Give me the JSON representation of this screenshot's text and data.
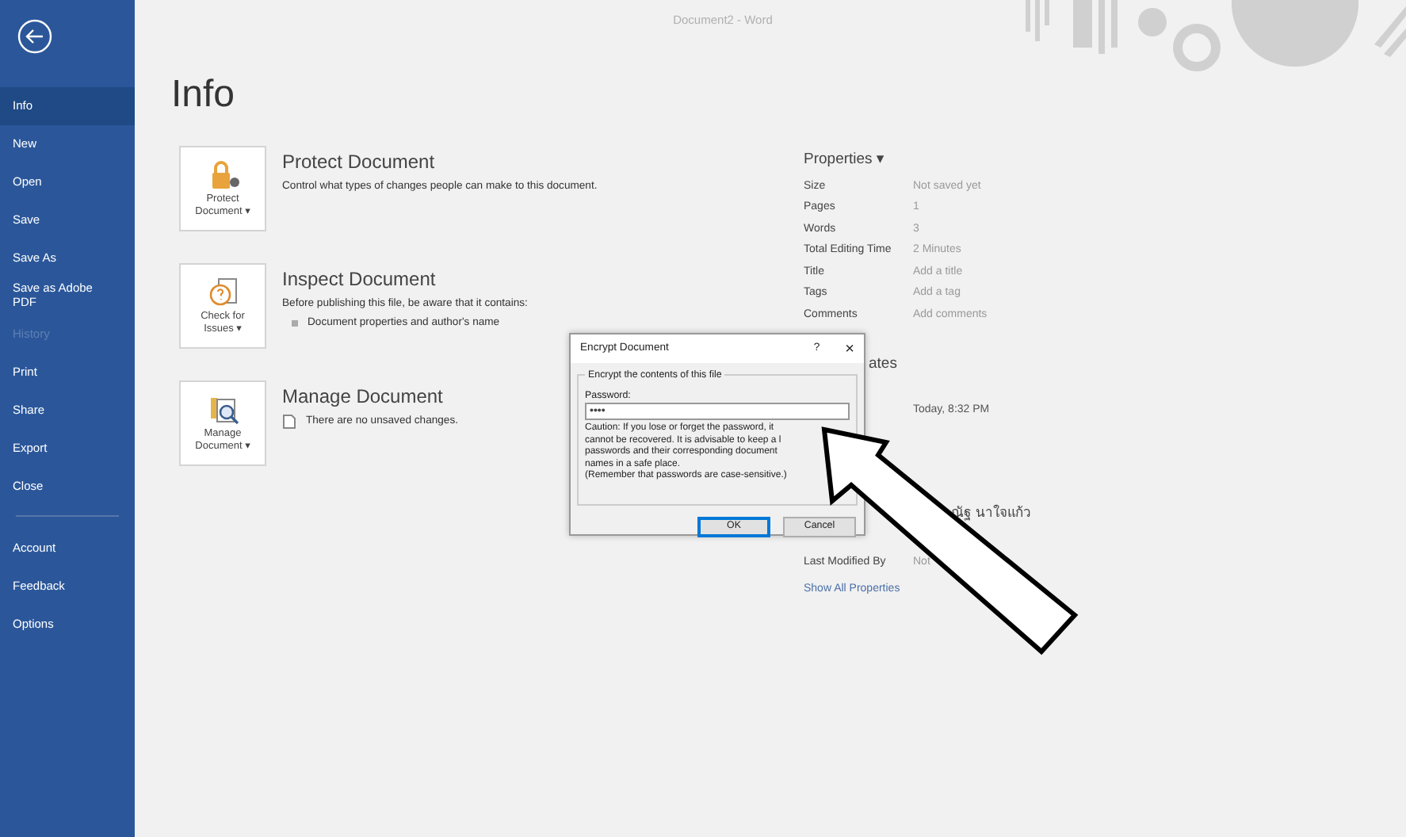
{
  "window": {
    "title": "Document2  -  Word"
  },
  "sidebar": {
    "items": [
      {
        "label": "Info",
        "selected": true,
        "disabled": false
      },
      {
        "label": "New",
        "selected": false,
        "disabled": false
      },
      {
        "label": "Open",
        "selected": false,
        "disabled": false
      },
      {
        "label": "Save",
        "selected": false,
        "disabled": false
      },
      {
        "label": "Save As",
        "selected": false,
        "disabled": false
      },
      {
        "label": "Save as Adobe PDF",
        "selected": false,
        "disabled": false
      },
      {
        "label": "History",
        "selected": false,
        "disabled": true
      },
      {
        "label": "Print",
        "selected": false,
        "disabled": false
      },
      {
        "label": "Share",
        "selected": false,
        "disabled": false
      },
      {
        "label": "Export",
        "selected": false,
        "disabled": false
      },
      {
        "label": "Close",
        "selected": false,
        "disabled": false
      },
      {
        "kind": "divider"
      },
      {
        "label": "Account",
        "selected": false,
        "disabled": false
      },
      {
        "label": "Feedback",
        "selected": false,
        "disabled": false
      },
      {
        "label": "Options",
        "selected": false,
        "disabled": false
      }
    ]
  },
  "page_title": "Info",
  "sections": [
    {
      "button": [
        "Protect",
        "Document ▾"
      ],
      "title": "Protect Document",
      "lines": [
        {
          "kind": "text",
          "text": "Control what types of changes people can make to this document."
        }
      ]
    },
    {
      "button": [
        "Check for",
        "Issues ▾"
      ],
      "title": "Inspect Document",
      "lines": [
        {
          "kind": "text",
          "text": "Before publishing this file, be aware that it contains:"
        },
        {
          "kind": "bullet",
          "text": "Document properties and author's name"
        }
      ]
    },
    {
      "button": [
        "Manage",
        "Document ▾"
      ],
      "title": "Manage Document",
      "lines": [
        {
          "kind": "page",
          "text": "There are no unsaved changes."
        }
      ]
    }
  ],
  "properties": {
    "header": "Properties ▾",
    "rows": [
      {
        "label": "Size",
        "value": "Not saved yet"
      },
      {
        "label": "Pages",
        "value": "1"
      },
      {
        "label": "Words",
        "value": "3"
      },
      {
        "label": "Total Editing Time",
        "value": "2 Minutes"
      },
      {
        "label": "Title",
        "value": "Add a title"
      },
      {
        "label": "Tags",
        "value": "Add a tag"
      },
      {
        "label": "Comments",
        "value": "Add comments"
      }
    ],
    "dates_header": "ates",
    "date_value": "Today, 8:32 PM",
    "author": "ณัฐ นาใจแก้ว",
    "last_modified_label": "Last Modified By",
    "last_modified_value": "Not",
    "link": "Show All Properties"
  },
  "dialog": {
    "title": "Encrypt Document",
    "help": "?",
    "close": "×",
    "group": "Encrypt the contents of this file",
    "password_label": "Password:",
    "password_value": "••••",
    "caution": [
      "Caution: If you lose or forget the password, it",
      "cannot be recovered. It is advisable to keep a l",
      "passwords and their corresponding document",
      "names in a safe place.",
      "(Remember that passwords are case-sensitive.)"
    ],
    "buttons": [
      {
        "label": "OK",
        "selected": true
      },
      {
        "label": "Cancel",
        "selected": false
      }
    ]
  }
}
